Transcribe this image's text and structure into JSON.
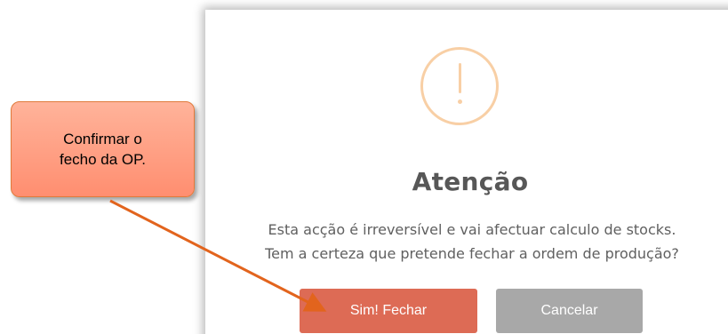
{
  "dialog": {
    "icon": "exclamation-icon",
    "title": "Atenção",
    "message_line1": "Esta acção é irreversível e vai afectuar calculo de stocks.",
    "message_line2": "Tem a certeza que pretende fechar a ordem de produção?",
    "confirm_label": "Sim! Fechar",
    "cancel_label": "Cancelar"
  },
  "callout": {
    "line1": "Confirmar o",
    "line2": "fecho da OP."
  },
  "colors": {
    "confirm": "#dd6b55",
    "cancel": "#a8a8a8",
    "icon": "#f8cfa5",
    "callout_fill": "#ff9a7e",
    "arrow": "#e2641d"
  }
}
